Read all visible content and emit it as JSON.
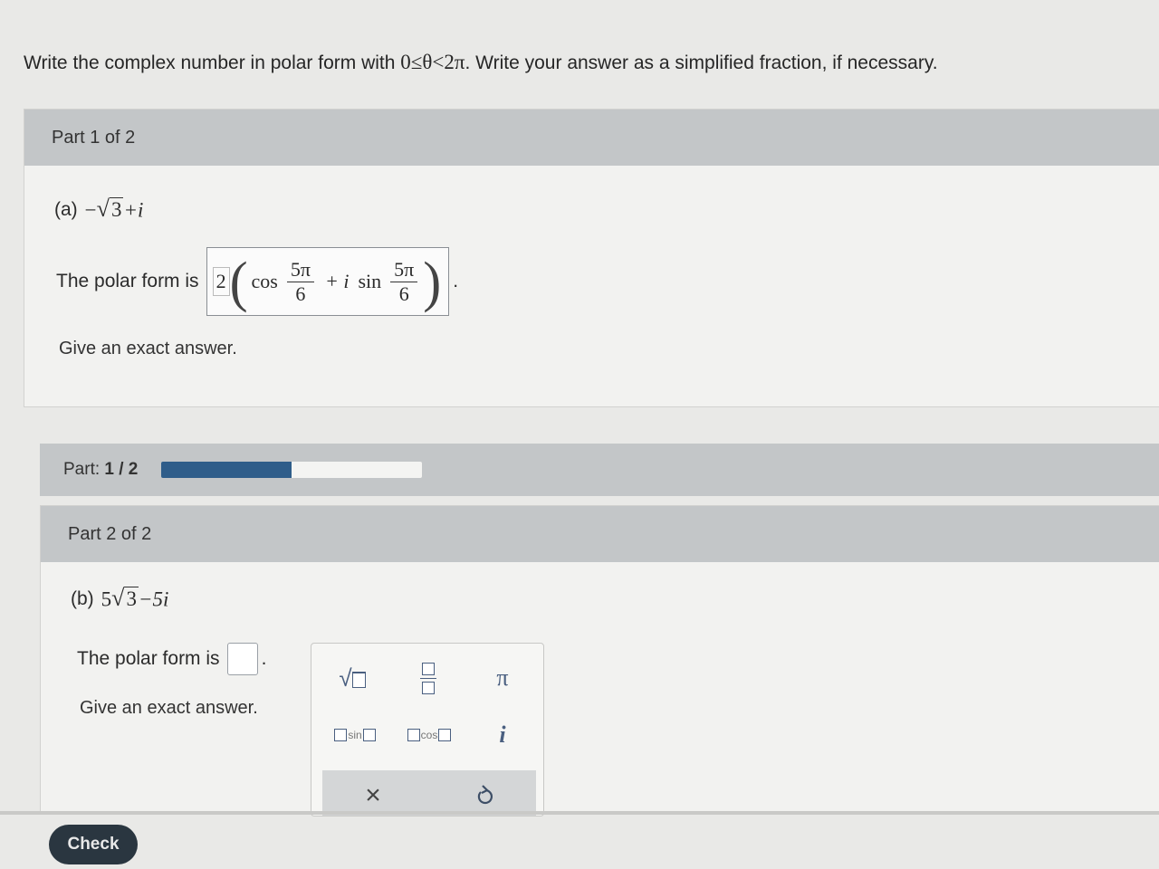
{
  "instructions": {
    "prefix": "Write the complex number in polar form with ",
    "condition": "0≤θ<2π",
    "suffix": ". Write your answer as a simplified fraction, if necessary."
  },
  "part1": {
    "header": "Part 1 of 2",
    "label": "(a)",
    "expr_sign": "−",
    "expr_radicand": "3",
    "expr_rest": "+i",
    "polar_prefix": "The polar form is",
    "answer": {
      "coefficient": "2",
      "cos": "cos",
      "angle_num": "5π",
      "angle_den": "6",
      "plus_i": "+ i",
      "sin": "sin",
      "angle2_num": "5π",
      "angle2_den": "6"
    },
    "period": ".",
    "hint": "Give an exact answer."
  },
  "progress": {
    "label_prefix": "Part: ",
    "label_value": "1 / 2",
    "fraction": 0.5
  },
  "part2": {
    "header": "Part 2 of 2",
    "label": "(b)",
    "expr_coef": "5",
    "expr_radicand": "3",
    "expr_rest": "−5i",
    "polar_prefix": "The polar form is",
    "period": ".",
    "hint": "Give an exact answer."
  },
  "keypad": {
    "pi": "π",
    "sin": "sin",
    "cos": "cos",
    "i": "i",
    "clear": "×"
  },
  "check_label": "Check"
}
